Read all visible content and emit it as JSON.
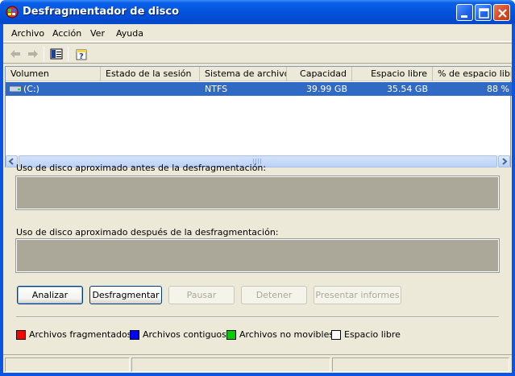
{
  "window": {
    "title": "Desfragmentador de disco"
  },
  "menu": [
    "Archivo",
    "Acción",
    "Ver",
    "Ayuda"
  ],
  "columns": [
    "Volumen",
    "Estado de la sesión",
    "Sistema de archivos",
    "Capacidad",
    "Espacio libre",
    "% de espacio libre"
  ],
  "volumes": [
    {
      "volume": "(C:)",
      "status": "",
      "filesystem": "NTFS",
      "capacity": "39.99 GB",
      "free": "35.54 GB",
      "percent_free": "88 %"
    }
  ],
  "analysis": {
    "before_label": "Uso de disco aproximado antes de la desfragmentación:",
    "after_label": "Uso de disco aproximado después de la desfragmentación:"
  },
  "buttons": {
    "analyze": "Analizar",
    "defragment": "Desfragmentar",
    "pause": "Pausar",
    "stop": "Detener",
    "report": "Presentar informes"
  },
  "legend": [
    {
      "label": "Archivos fragmentados",
      "color": "#ff0000"
    },
    {
      "label": "Archivos contiguos",
      "color": "#0000ff"
    },
    {
      "label": "Archivos no movibles",
      "color": "#00cc00"
    },
    {
      "label": "Espacio libre",
      "color": "#ffffff"
    }
  ],
  "colors": {
    "titlebar": "#0453dd",
    "selection": "#316ac5",
    "graph_empty": "#aca899"
  }
}
